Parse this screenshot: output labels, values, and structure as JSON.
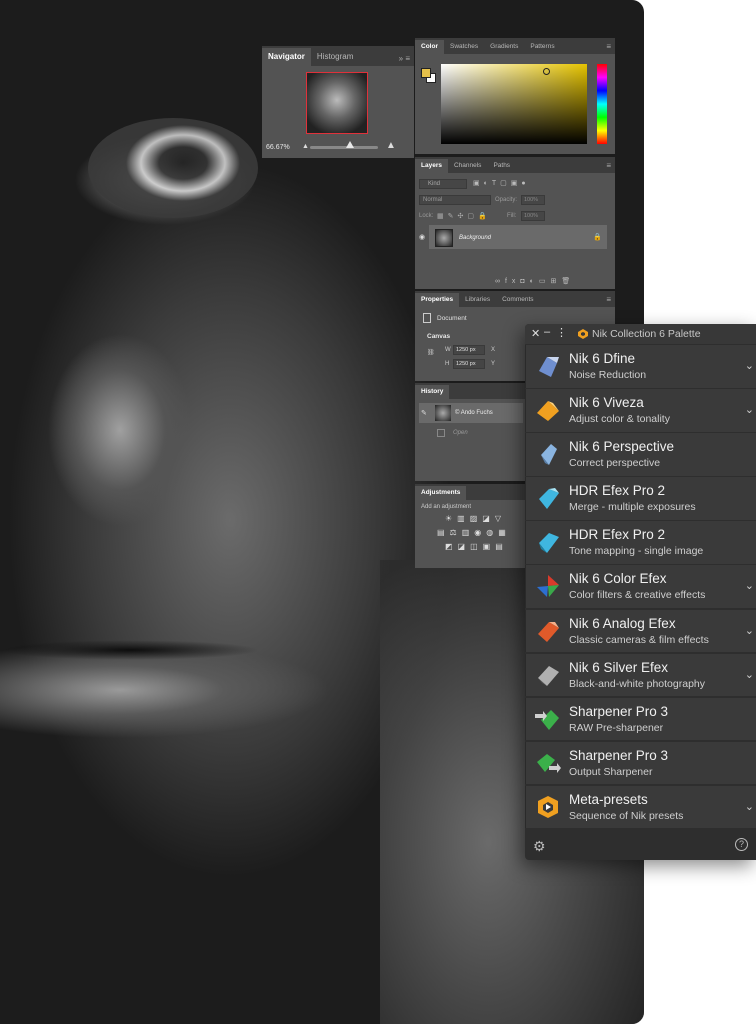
{
  "navigator": {
    "tabs": [
      "Navigator",
      "Histogram"
    ],
    "zoom": "66.67%"
  },
  "color": {
    "tabs": [
      "Color",
      "Swatches",
      "Gradients",
      "Patterns"
    ],
    "foreground": "#e6c14a"
  },
  "layers": {
    "tabs": [
      "Layers",
      "Channels",
      "Paths"
    ],
    "filter_label": "Kind",
    "blend_mode": "Normal",
    "opacity_label": "Opacity:",
    "opacity_value": "100%",
    "lock_label": "Lock:",
    "fill_label": "Fill:",
    "fill_value": "100%",
    "layer_name": "Background"
  },
  "properties": {
    "tabs": [
      "Properties",
      "Libraries",
      "Comments"
    ],
    "document_label": "Document",
    "canvas_label": "Canvas",
    "w_label": "W",
    "w_value": "1250 px",
    "h_label": "H",
    "h_value": "1250 px",
    "x_label": "X",
    "y_label": "Y"
  },
  "history": {
    "tabs": [
      "History"
    ],
    "snapshot_name": "© Ando Fuchs",
    "step": "Open"
  },
  "adjustments": {
    "tabs": [
      "Adjustments"
    ],
    "add_label": "Add an adjustment"
  },
  "nik_palette": {
    "title": "Nik Collection 6 Palette",
    "items": [
      {
        "name": "Nik 6 Dfine",
        "subtitle": "Noise Reduction",
        "expandable": true,
        "icon": "dfine-icon"
      },
      {
        "name": "Nik 6 Viveza",
        "subtitle": "Adjust color & tonality",
        "expandable": true,
        "icon": "viveza-icon"
      },
      {
        "name": "Nik 6 Perspective",
        "subtitle": "Correct perspective",
        "expandable": false,
        "icon": "perspective-icon"
      },
      {
        "name": "HDR Efex Pro 2",
        "subtitle": "Merge - multiple exposures",
        "expandable": false,
        "icon": "hdr-merge-icon"
      },
      {
        "name": "HDR Efex Pro 2",
        "subtitle": "Tone mapping - single image",
        "expandable": false,
        "icon": "hdr-tonemap-icon"
      },
      {
        "name": "Nik 6 Color Efex",
        "subtitle": "Color filters & creative effects",
        "expandable": true,
        "icon": "color-efex-icon"
      },
      {
        "name": "Nik 6 Analog Efex",
        "subtitle": "Classic cameras & film effects",
        "expandable": true,
        "icon": "analog-efex-icon"
      },
      {
        "name": "Nik 6 Silver Efex",
        "subtitle": "Black-and-white photography",
        "expandable": true,
        "icon": "silver-efex-icon"
      },
      {
        "name": "Sharpener Pro 3",
        "subtitle": "RAW Pre-sharpener",
        "expandable": false,
        "icon": "sharpener-raw-icon"
      },
      {
        "name": "Sharpener Pro 3",
        "subtitle": "Output Sharpener",
        "expandable": false,
        "icon": "sharpener-output-icon"
      },
      {
        "name": "Meta-presets",
        "subtitle": "Sequence of Nik presets",
        "expandable": true,
        "icon": "meta-presets-icon"
      }
    ],
    "icon_colors": {
      "dfine": "#6f8fd0",
      "viveza": "#f0a020",
      "perspective": "#8ab4e0",
      "hdr": "#3fb6e0",
      "color_efex_red": "#d93a2b",
      "color_efex_green": "#3aa84a",
      "color_efex_blue": "#2d6fd0",
      "analog": "#e05a2a",
      "silver": "#b0b0b0",
      "sharpener": "#3bb04a",
      "meta": "#f0a020"
    }
  }
}
